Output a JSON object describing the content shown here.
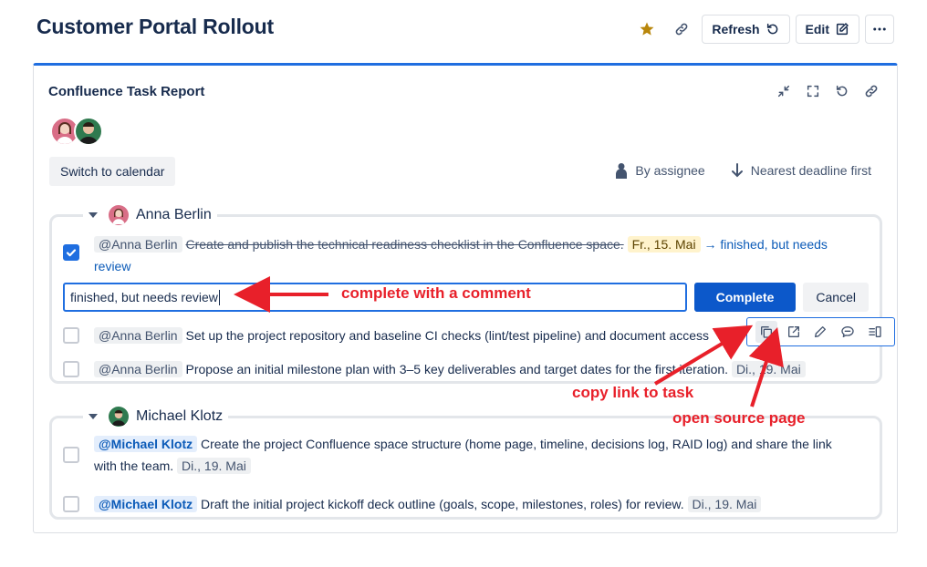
{
  "page": {
    "title": "Customer Portal Rollout"
  },
  "top_actions": {
    "refresh_label": "Refresh",
    "edit_label": "Edit"
  },
  "colors": {
    "accent": "#1f6ee0",
    "primary": "#0c58ca",
    "star": "#b8860b",
    "annotation": "#e8202a"
  },
  "report": {
    "title": "Confluence Task Report",
    "switch_label": "Switch to calendar",
    "sort_assignee": "By assignee",
    "sort_deadline": "Nearest deadline first"
  },
  "groups": [
    {
      "assignee": "Anna Berlin",
      "tasks": [
        {
          "mention": "@Anna Berlin",
          "text": "Create and publish the technical readiness checklist in the Confluence space.",
          "date": "Fr., 15. Mai",
          "arrow": "→",
          "note_line1": "finished, but needs",
          "note_line2": "review",
          "checked": true
        },
        {
          "mention": "@Anna Berlin",
          "text": "Set up the project repository and baseline CI checks (lint/test pipeline) and document access",
          "checked": false
        },
        {
          "mention": "@Anna Berlin",
          "text": "Propose an initial milestone plan with 3–5 key deliverables and target dates for the first iteration.",
          "date": "Di., 19. Mai",
          "checked": false
        }
      ]
    },
    {
      "assignee": "Michael Klotz",
      "tasks": [
        {
          "mention": "@Michael Klotz",
          "text": "Create the project Confluence space structure (home page, timeline, decisions log, RAID log) and share the link",
          "text_line2": "with the team.",
          "date": "Di., 19. Mai",
          "checked": false
        },
        {
          "mention": "@Michael Klotz",
          "text": "Draft the initial project kickoff deck outline (goals, scope, milestones, roles) for review.",
          "date": "Di., 19. Mai",
          "checked": false
        }
      ]
    }
  ],
  "comment": {
    "value": "finished, but needs review",
    "complete_label": "Complete",
    "cancel_label": "Cancel"
  },
  "annotations": {
    "complete_with_comment": "complete with a comment",
    "copy_link": "copy link to task",
    "open_source": "open source page"
  }
}
